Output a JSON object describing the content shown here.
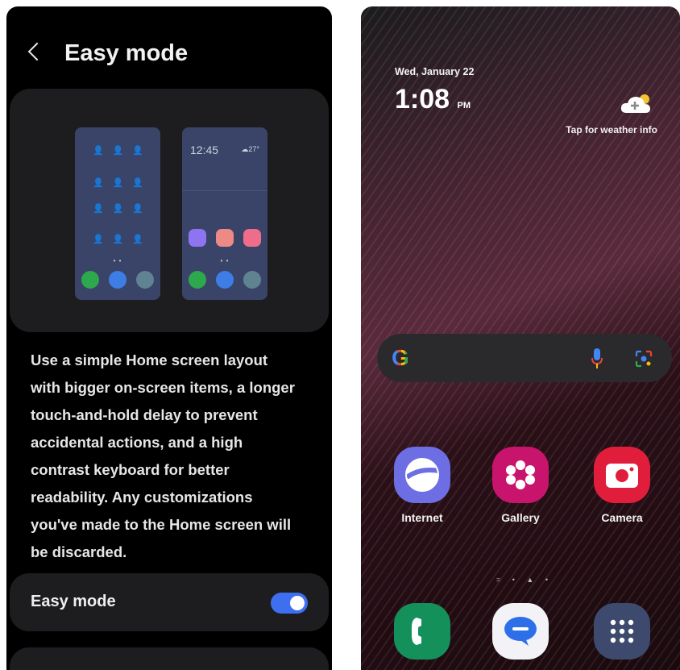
{
  "settings": {
    "title": "Easy mode",
    "preview": {
      "clock": "12:45",
      "weather": "☁27°",
      "person_icon": "👤",
      "page_dots": "• •"
    },
    "description": "Use a simple Home screen layout with bigger on-screen items, a longer touch-and-hold delay to prevent accidental actions, and a high contrast keyboard for better readability. Any customizations you've made to the Home screen will be discarded.",
    "toggle_row": {
      "label": "Easy mode",
      "enabled": true
    },
    "colors": {
      "accent": "#3e6ff0",
      "background": "#000000",
      "card": "#1d1d1f"
    }
  },
  "home": {
    "date": "Wed, January 22",
    "time": "1:08",
    "ampm": "PM",
    "weather_hint": "Tap for weather info",
    "search": {
      "logo": "G",
      "mic_icon": "mic-icon",
      "lens_icon": "lens-icon"
    },
    "apps": [
      {
        "label": "Internet",
        "icon": "internet-icon",
        "color": "#6d6ee3"
      },
      {
        "label": "Gallery",
        "icon": "gallery-icon",
        "color": "#c8146c"
      },
      {
        "label": "Camera",
        "icon": "camera-icon",
        "color": "#e01e3c"
      }
    ],
    "page_indicator": "= • ▲ •",
    "dock": [
      {
        "icon": "phone-icon",
        "color": "#14915a"
      },
      {
        "icon": "messages-icon",
        "color": "#f3f3f7"
      },
      {
        "icon": "apps-drawer-icon",
        "color": "#3d4a6d"
      }
    ]
  }
}
